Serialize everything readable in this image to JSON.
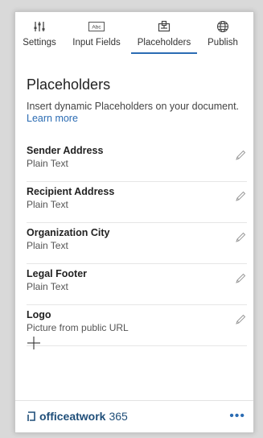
{
  "tabs": [
    {
      "label": "Settings",
      "icon": "sliders-icon"
    },
    {
      "label": "Input Fields",
      "icon": "text-field-icon",
      "icon_text": "Abc"
    },
    {
      "label": "Placeholders",
      "icon": "placeholder-icon",
      "active": true
    },
    {
      "label": "Publish",
      "icon": "globe-icon"
    }
  ],
  "main": {
    "title": "Placeholders",
    "description": "Insert dynamic Placeholders on your document.",
    "learn_more": "Learn more"
  },
  "placeholders": [
    {
      "name": "Sender Address",
      "type": "Plain Text"
    },
    {
      "name": "Recipient Address",
      "type": "Plain Text"
    },
    {
      "name": "Organization City",
      "type": "Plain Text"
    },
    {
      "name": "Legal Footer",
      "type": "Plain Text"
    },
    {
      "name": "Logo",
      "type": "Picture from public URL"
    }
  ],
  "footer": {
    "brand": "officeatwork",
    "suffix": "365",
    "more": "•••"
  },
  "colors": {
    "accent": "#2b6cb3",
    "brand": "#1f4e79"
  }
}
